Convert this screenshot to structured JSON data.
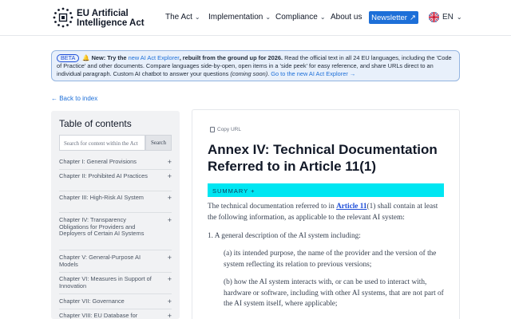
{
  "header": {
    "logo_line1": "EU Artificial",
    "logo_line2": "Intelligence Act",
    "nav": [
      {
        "label": "The Act",
        "has_dropdown": true
      },
      {
        "label": "Implementation",
        "has_dropdown": true
      },
      {
        "label": "Compliance",
        "has_dropdown": true
      },
      {
        "label": "About us",
        "has_dropdown": false
      }
    ],
    "newsletter_label": "Newsletter",
    "language": "EN"
  },
  "banner": {
    "badge": "BETA",
    "new_label": "New: Try the",
    "explorer_link": "new AI Act Explorer",
    "lead": ", rebuilt from the ground up for 2026.",
    "body": " Read the official text in all 24 EU languages, including the 'Code of Practice' and other documents. Compare languages side-by-open, open items in a 'side peek' for easy reference, and share URLs direct to an individual paragraph. Custom AI chatbot to answer your questions ",
    "soon": "(coming soon)",
    "cta": "Go to the new AI Act Explorer →"
  },
  "back_link": "← Back to index",
  "sidebar": {
    "title": "Table of contents",
    "search_placeholder": "Search for content within the Act",
    "search_button": "Search",
    "chapters": [
      "Chapter I: General Provisions",
      "Chapter II: Prohibited AI Practices",
      "Chapter III: High-Risk AI System",
      "Chapter IV: Transparency Obligations for Providers and Deployers of Certain AI Systems",
      "Chapter V: General-Purpose AI Models",
      "Chapter VI: Measures in Support of Innovation",
      "Chapter VII: Governance",
      "Chapter VIII: EU Database for"
    ]
  },
  "main": {
    "copy_url": "Copy URL",
    "title": "Annex IV: Technical Documentation Referred to in Article 11(1)",
    "summary_label": "SUMMARY +",
    "intro_before": "The technical documentation referred to in ",
    "intro_link": "Article 11",
    "intro_after": "(1) shall contain at least the following information, as applicable to the relevant AI system:",
    "item1": "1. A general description of the AI system including:",
    "item1a": "(a) its intended purpose, the name of the provider and the version of the system reflecting its relation to previous versions;",
    "item1b": "(b) how the AI system interacts with, or can be used to interact with, hardware or software, including with other AI systems, that are not part of the AI system itself, where applicable;"
  }
}
